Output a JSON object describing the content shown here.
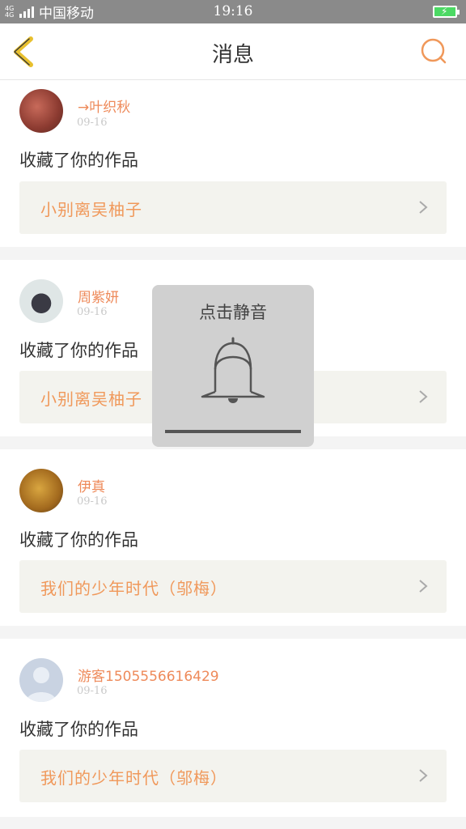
{
  "status_bar": {
    "network": "4G 4G",
    "carrier": "中国移动",
    "time": "19:16",
    "battery_icon": "battery-charging-icon"
  },
  "header": {
    "title": "消息",
    "back_icon": "chevron-left-icon",
    "search_icon": "search-icon",
    "accent_color": "#e8c02e",
    "search_color": "#f0985a"
  },
  "messages": [
    {
      "user": "→叶织秋",
      "date": "09-16",
      "action": "收藏了你的作品",
      "work": "小别离吴柚子",
      "avatar": "avatar-photo-icon"
    },
    {
      "user": "周紫妍",
      "date": "09-16",
      "action": "收藏了你的作品",
      "work": "小别离吴柚子",
      "avatar": "avatar-photo-icon"
    },
    {
      "user": "伊真",
      "date": "09-16",
      "action": "收藏了你的作品",
      "work": "我们的少年时代（邬梅）",
      "avatar": "avatar-photo-icon"
    },
    {
      "user": "游客15055566164​29",
      "date": "09-16",
      "action": "收藏了你的作品",
      "work": "我们的少年时代（邬梅）",
      "avatar": "default-avatar-icon"
    }
  ],
  "toast": {
    "text": "点击静音",
    "icon": "bell-icon"
  }
}
